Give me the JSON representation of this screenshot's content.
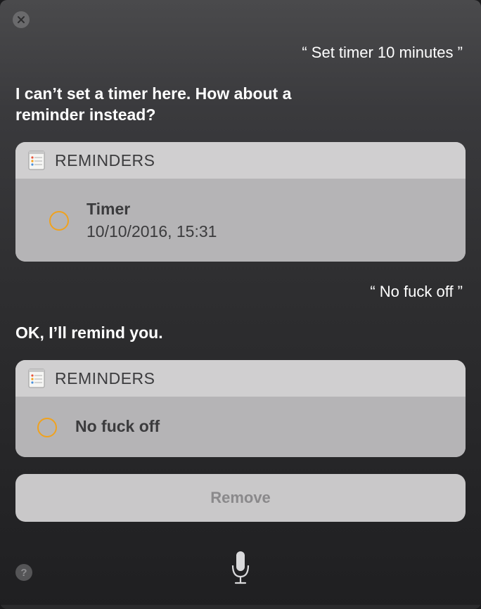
{
  "conversation": {
    "user_query_1": "“ Set timer 10 minutes ”",
    "siri_reply_1": "I can’t set a timer here. How about a reminder instead?",
    "user_query_2": "“ No fuck off ”",
    "siri_reply_2": "OK, I’ll remind you."
  },
  "card_1": {
    "app_name": "REMINDERS",
    "icon": "reminders-app-icon",
    "reminder": {
      "title": "Timer",
      "date": "10/10/2016, 15:31",
      "completed": false
    }
  },
  "card_2": {
    "app_name": "REMINDERS",
    "icon": "reminders-app-icon",
    "reminder": {
      "title": "No fuck off",
      "completed": false
    }
  },
  "actions": {
    "remove_label": "Remove"
  },
  "controls": {
    "close_icon": "close-icon",
    "help_label": "?",
    "mic_icon": "microphone-icon"
  },
  "colors": {
    "accent_orange": "#f0a21e",
    "card_header": "#d0cfd0",
    "card_body": "#b5b4b6",
    "text_dark": "#3b3b3d"
  }
}
